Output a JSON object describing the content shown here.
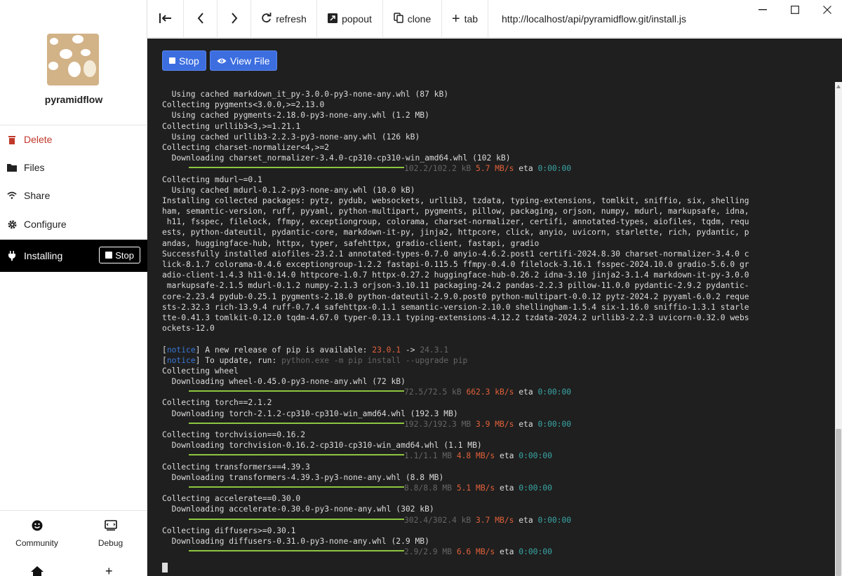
{
  "app": {
    "name": "pyramidflow"
  },
  "sidebar": {
    "items": [
      {
        "label": "Delete",
        "icon": "trash-icon"
      },
      {
        "label": "Files",
        "icon": "folder-icon"
      },
      {
        "label": "Share",
        "icon": "wifi-icon"
      },
      {
        "label": "Configure",
        "icon": "gear-icon"
      },
      {
        "label": "Installing",
        "icon": "plug-icon",
        "stop_label": "Stop"
      }
    ],
    "bottom": [
      {
        "label": "Community",
        "icon": "smiley-icon"
      },
      {
        "label": "Debug",
        "icon": "terminal-icon"
      }
    ]
  },
  "topbar": {
    "refresh": "refresh",
    "popout": "popout",
    "clone": "clone",
    "tab": "tab",
    "url": "http://localhost/api/pyramidflow.git/install.js"
  },
  "terminal": {
    "stop_label": "Stop",
    "view_file_label": "View File",
    "lines": [
      "  Using cached markdown_it_py-3.0.0-py3-none-any.whl (87 kB)",
      "Collecting pygments<3.0.0,>=2.13.0",
      "  Using cached pygments-2.18.0-py3-none-any.whl (1.2 MB)",
      "Collecting urllib3<3,>=1.21.1",
      "  Using cached urllib3-2.2.3-py3-none-any.whl (126 kB)",
      "Collecting charset-normalizer<4,>=2",
      "  Downloading charset_normalizer-3.4.0-cp310-cp310-win_amd64.whl (102 kB)",
      {
        "progress": true,
        "size": "102.2/102.2 kB",
        "speed": "5.7 MB/s",
        "eta": "0:00:00"
      },
      "Collecting mdurl~=0.1",
      "  Using cached mdurl-0.1.2-py3-none-any.whl (10.0 kB)",
      "Installing collected packages: pytz, pydub, websockets, urllib3, tzdata, typing-extensions, tomlkit, sniffio, six, shelling",
      "ham, semantic-version, ruff, pyyaml, python-multipart, pygments, pillow, packaging, orjson, numpy, mdurl, markupsafe, idna,",
      " h11, fsspec, filelock, ffmpy, exceptiongroup, colorama, charset-normalizer, certifi, annotated-types, aiofiles, tqdm, requ",
      "ests, python-dateutil, pydantic-core, markdown-it-py, jinja2, httpcore, click, anyio, uvicorn, starlette, rich, pydantic, p",
      "andas, huggingface-hub, httpx, typer, safehttpx, gradio-client, fastapi, gradio",
      "Successfully installed aiofiles-23.2.1 annotated-types-0.7.0 anyio-4.6.2.post1 certifi-2024.8.30 charset-normalizer-3.4.0 c",
      "lick-8.1.7 colorama-0.4.6 exceptiongroup-1.2.2 fastapi-0.115.5 ffmpy-0.4.0 filelock-3.16.1 fsspec-2024.10.0 gradio-5.6.0 gr",
      "adio-client-1.4.3 h11-0.14.0 httpcore-1.0.7 httpx-0.27.2 huggingface-hub-0.26.2 idna-3.10 jinja2-3.1.4 markdown-it-py-3.0.0",
      " markupsafe-2.1.5 mdurl-0.1.2 numpy-2.1.3 orjson-3.10.11 packaging-24.2 pandas-2.2.3 pillow-11.0.0 pydantic-2.9.2 pydantic-",
      "core-2.23.4 pydub-0.25.1 pygments-2.18.0 python-dateutil-2.9.0.post0 python-multipart-0.0.12 pytz-2024.2 pyyaml-6.0.2 reque",
      "sts-2.32.3 rich-13.9.4 ruff-0.7.4 safehttpx-0.1.1 semantic-version-2.10.0 shellingham-1.5.4 six-1.16.0 sniffio-1.3.1 starle",
      "tte-0.41.3 tomlkit-0.12.0 tqdm-4.67.0 typer-0.13.1 typing-extensions-4.12.2 tzdata-2024.2 urllib3-2.2.3 uvicorn-0.32.0 webs",
      "ockets-12.0",
      "",
      {
        "notice": true,
        "tag": "notice",
        "text": " A new release of pip is available: ",
        "old": "23.0.1",
        "arrow": " -> ",
        "new": "24.3.1"
      },
      {
        "notice2": true,
        "tag": "notice",
        "text": " To update, run: ",
        "cmd": "python.exe -m pip install --upgrade pip"
      },
      "Collecting wheel",
      "  Downloading wheel-0.45.0-py3-none-any.whl (72 kB)",
      {
        "progress": true,
        "size": "72.5/72.5 kB",
        "speed": "662.3 kB/s",
        "eta": "0:00:00"
      },
      "Collecting torch==2.1.2",
      "  Downloading torch-2.1.2-cp310-cp310-win_amd64.whl (192.3 MB)",
      {
        "progress": true,
        "size": "192.3/192.3 MB",
        "speed": "3.9 MB/s",
        "eta": "0:00:00"
      },
      "Collecting torchvision==0.16.2",
      "  Downloading torchvision-0.16.2-cp310-cp310-win_amd64.whl (1.1 MB)",
      {
        "progress": true,
        "size": "1.1/1.1 MB",
        "speed": "4.8 MB/s",
        "eta": "0:00:00"
      },
      "Collecting transformers==4.39.3",
      "  Downloading transformers-4.39.3-py3-none-any.whl (8.8 MB)",
      {
        "progress": true,
        "size": "8.8/8.8 MB",
        "speed": "5.1 MB/s",
        "eta": "0:00:00"
      },
      "Collecting accelerate==0.30.0",
      "  Downloading accelerate-0.30.0-py3-none-any.whl (302 kB)",
      {
        "progress": true,
        "size": "302.4/302.4 kB",
        "speed": "3.7 MB/s",
        "eta": "0:00:00"
      },
      "Collecting diffusers>=0.30.1",
      "  Downloading diffusers-0.31.0-py3-none-any.whl (2.9 MB)",
      {
        "progress": true,
        "size": "2.9/2.9 MB",
        "speed": "6.6 MB/s",
        "eta": "0:00:00"
      }
    ],
    "eta_label": "eta"
  },
  "colors": {
    "accent": "#3c6ee0",
    "progress_bar": "#8dc63f",
    "speed": "#e0603a",
    "eta": "#3aa5a5",
    "notice": "#3a78d8",
    "terminal_bg": "#1f1f1f"
  }
}
